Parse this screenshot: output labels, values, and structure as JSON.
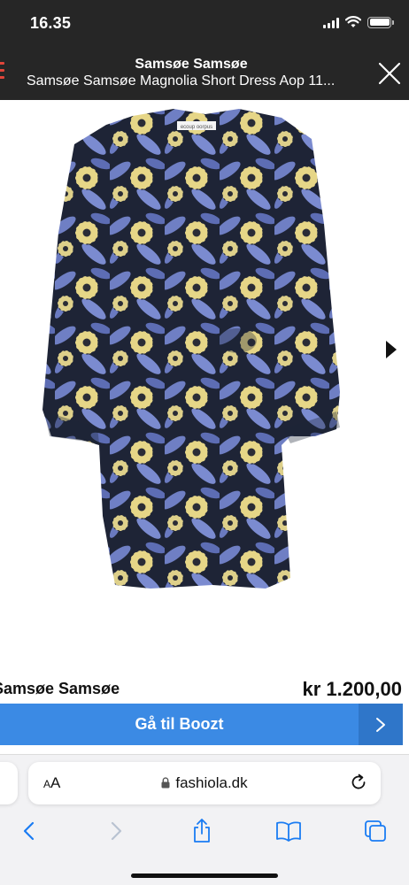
{
  "status_bar": {
    "time": "16.35"
  },
  "modal": {
    "title": "Samsøe Samsøe",
    "subtitle": "Samsøe Samsøe Magnolia Short Dress Aop 11..."
  },
  "product": {
    "brand": "Samsøe Samsøe",
    "price": "kr 1.200,00",
    "cta_label": "Gå til Boozt",
    "image_label": "ecoup oorpus"
  },
  "browser": {
    "aa_small": "A",
    "aa_large": "A",
    "url": "fashiola.dk"
  },
  "colors": {
    "topbar": "#262626",
    "cta": "#3b8ae4",
    "cta_arrow": "#2f76c9",
    "safari_blue": "#1a7cf3",
    "dress_blue": "#6f7fc4",
    "dress_yellow": "#e8d98a",
    "dress_dark": "#1e2436"
  }
}
